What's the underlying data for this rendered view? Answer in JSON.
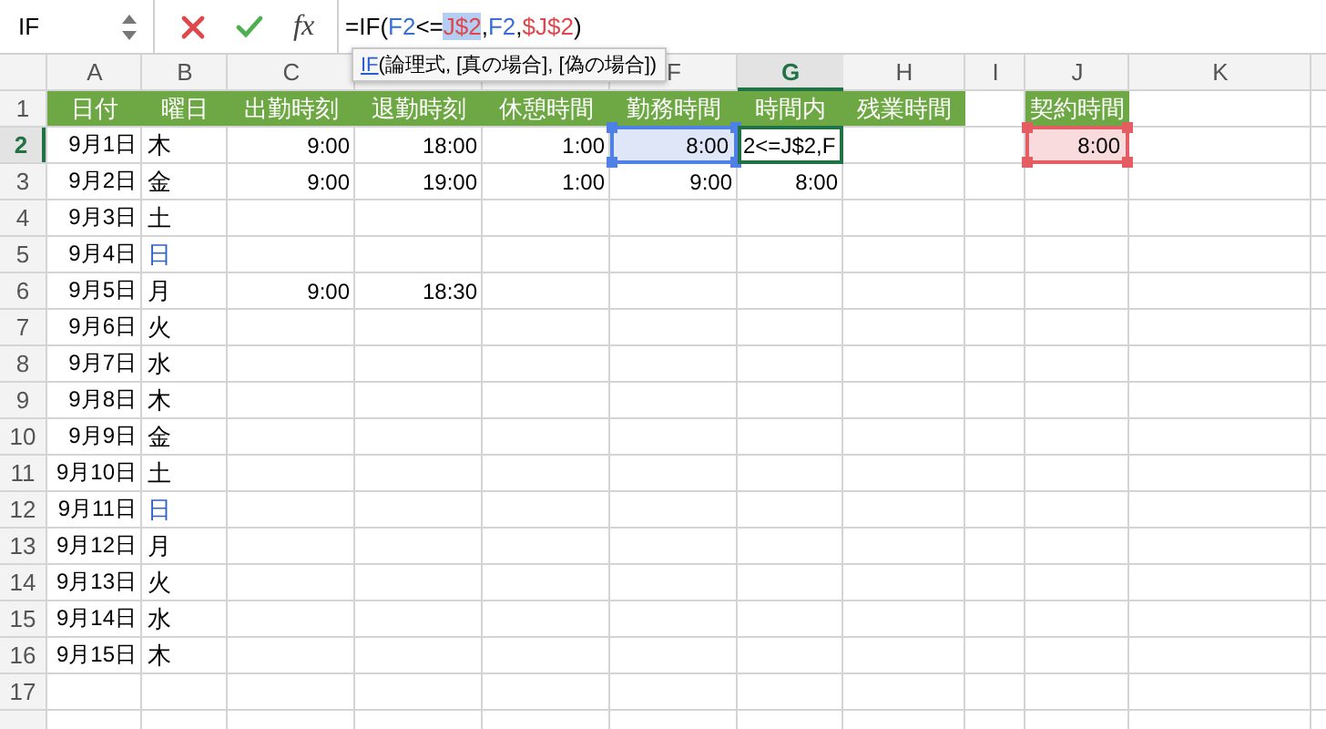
{
  "formula_bar": {
    "name_box": "IF",
    "function_label": "fx",
    "formula": [
      {
        "text": "=IF(",
        "color": "#000000",
        "selected": false
      },
      {
        "text": "F2",
        "color": "#3a6fd8",
        "selected": false
      },
      {
        "text": "<=",
        "color": "#000000",
        "selected": false
      },
      {
        "text": "J$2",
        "color": "#e0474c",
        "selected": true
      },
      {
        "text": ",",
        "color": "#000000",
        "selected": false
      },
      {
        "text": "F2",
        "color": "#3a6fd8",
        "selected": false
      },
      {
        "text": ",",
        "color": "#000000",
        "selected": false
      },
      {
        "text": "$J$2",
        "color": "#e0474c",
        "selected": false
      },
      {
        "text": ")",
        "color": "#000000",
        "selected": false
      }
    ]
  },
  "tooltip": {
    "function": "IF",
    "arguments": "(論理式, [真の場合], [偽の場合])"
  },
  "columns": [
    {
      "label": "A",
      "selected": false
    },
    {
      "label": "B",
      "selected": false
    },
    {
      "label": "C",
      "selected": false
    },
    {
      "selected": false
    },
    {
      "selected": false
    },
    {
      "label": "F",
      "selected": false
    },
    {
      "label": "G",
      "selected": true
    },
    {
      "label": "H",
      "selected": false
    },
    {
      "label": "I",
      "selected": false
    },
    {
      "label": "J",
      "selected": false
    },
    {
      "label": "K",
      "selected": false
    }
  ],
  "rows": [
    {
      "number": "1",
      "selected": false,
      "cells": [
        {
          "text": "日付",
          "kind": "header"
        },
        {
          "text": "曜日",
          "kind": "header"
        },
        {
          "text": "出勤時刻",
          "kind": "header"
        },
        {
          "text": "退勤時刻",
          "kind": "header"
        },
        {
          "text": "休憩時間",
          "kind": "header"
        },
        {
          "text": "勤務時間",
          "kind": "header"
        },
        {
          "text": "時間内",
          "kind": "header"
        },
        {
          "text": "残業時間",
          "kind": "header"
        },
        {
          "kind": "empty"
        },
        {
          "text": "契約時間",
          "kind": "header"
        }
      ]
    },
    {
      "number": "2",
      "selected": true,
      "cells": [
        {
          "text": "9月1日",
          "kind": "value"
        },
        {
          "text": "木",
          "kind": "weekday",
          "color": "#000000"
        },
        {
          "text": "9:00",
          "kind": "value"
        },
        {
          "text": "18:00",
          "kind": "value"
        },
        {
          "text": "1:00",
          "kind": "value"
        },
        {
          "text": "8:00",
          "kind": "ref-blue"
        },
        {
          "text": "2<=J$2,F",
          "kind": "editing"
        },
        {
          "kind": "empty"
        },
        {
          "kind": "empty"
        },
        {
          "text": "8:00",
          "kind": "ref-red"
        }
      ]
    },
    {
      "number": "3",
      "selected": false,
      "cells": [
        {
          "text": "9月2日",
          "kind": "value"
        },
        {
          "text": "金",
          "kind": "weekday",
          "color": "#000000"
        },
        {
          "text": "9:00",
          "kind": "value"
        },
        {
          "text": "19:00",
          "kind": "value"
        },
        {
          "text": "1:00",
          "kind": "value"
        },
        {
          "text": "9:00",
          "kind": "value"
        },
        {
          "text": "8:00",
          "kind": "value"
        }
      ]
    },
    {
      "number": "4",
      "selected": false,
      "cells": [
        {
          "text": "9月3日",
          "kind": "value"
        },
        {
          "text": "土",
          "kind": "weekday",
          "color": "#000000"
        }
      ]
    },
    {
      "number": "5",
      "selected": false,
      "cells": [
        {
          "text": "9月4日",
          "kind": "value"
        },
        {
          "text": "日",
          "kind": "weekday",
          "color": "#2e64c8"
        }
      ]
    },
    {
      "number": "6",
      "selected": false,
      "cells": [
        {
          "text": "9月5日",
          "kind": "value"
        },
        {
          "text": "月",
          "kind": "weekday",
          "color": "#000000"
        },
        {
          "text": "9:00",
          "kind": "value"
        },
        {
          "text": "18:30",
          "kind": "value"
        }
      ]
    },
    {
      "number": "7",
      "selected": false,
      "cells": [
        {
          "text": "9月6日",
          "kind": "value"
        },
        {
          "text": "火",
          "kind": "weekday",
          "color": "#000000"
        }
      ]
    },
    {
      "number": "8",
      "selected": false,
      "cells": [
        {
          "text": "9月7日",
          "kind": "value"
        },
        {
          "text": "水",
          "kind": "weekday",
          "color": "#000000"
        }
      ]
    },
    {
      "number": "9",
      "selected": false,
      "cells": [
        {
          "text": "9月8日",
          "kind": "value"
        },
        {
          "text": "木",
          "kind": "weekday",
          "color": "#000000"
        }
      ]
    },
    {
      "number": "10",
      "selected": false,
      "cells": [
        {
          "text": "9月9日",
          "kind": "value"
        },
        {
          "text": "金",
          "kind": "weekday",
          "color": "#000000"
        }
      ]
    },
    {
      "number": "11",
      "selected": false,
      "cells": [
        {
          "text": "9月10日",
          "kind": "value"
        },
        {
          "text": "土",
          "kind": "weekday",
          "color": "#000000"
        }
      ]
    },
    {
      "number": "12",
      "selected": false,
      "cells": [
        {
          "text": "9月11日",
          "kind": "value"
        },
        {
          "text": "日",
          "kind": "weekday",
          "color": "#2e64c8"
        }
      ]
    },
    {
      "number": "13",
      "selected": false,
      "cells": [
        {
          "text": "9月12日",
          "kind": "value"
        },
        {
          "text": "月",
          "kind": "weekday",
          "color": "#000000"
        }
      ]
    },
    {
      "number": "14",
      "selected": false,
      "cells": [
        {
          "text": "9月13日",
          "kind": "value"
        },
        {
          "text": "火",
          "kind": "weekday",
          "color": "#000000"
        }
      ]
    },
    {
      "number": "15",
      "selected": false,
      "cells": [
        {
          "text": "9月14日",
          "kind": "value"
        },
        {
          "text": "水",
          "kind": "weekday",
          "color": "#000000"
        }
      ]
    },
    {
      "number": "16",
      "selected": false,
      "cells": [
        {
          "text": "9月15日",
          "kind": "value"
        },
        {
          "text": "木",
          "kind": "weekday",
          "color": "#000000"
        }
      ]
    },
    {
      "number": "17",
      "selected": false
    }
  ]
}
